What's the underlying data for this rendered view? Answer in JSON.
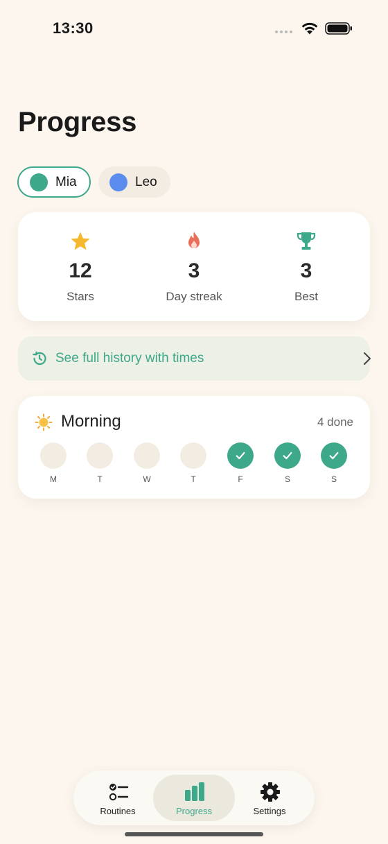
{
  "status_bar": {
    "time": "13:30"
  },
  "page": {
    "title": "Progress"
  },
  "profiles": [
    {
      "name": "Mia",
      "color": "#3ea88a",
      "selected": true
    },
    {
      "name": "Leo",
      "color": "#5b8def",
      "selected": false
    }
  ],
  "stats": [
    {
      "icon": "star-icon",
      "value": "12",
      "label": "Stars",
      "color": "#f5b82e"
    },
    {
      "icon": "flame-icon",
      "value": "3",
      "label": "Day streak",
      "color": "#ea6f5a"
    },
    {
      "icon": "trophy-icon",
      "value": "3",
      "label": "Best",
      "color": "#3ea88a"
    }
  ],
  "history_link": {
    "label": "See full history with times"
  },
  "routine": {
    "title": "Morning",
    "count": "4 done",
    "days": [
      {
        "label": "M",
        "done": false
      },
      {
        "label": "T",
        "done": false
      },
      {
        "label": "W",
        "done": false
      },
      {
        "label": "T",
        "done": false
      },
      {
        "label": "F",
        "done": true
      },
      {
        "label": "S",
        "done": true
      },
      {
        "label": "S",
        "done": true
      }
    ]
  },
  "tab_bar": {
    "items": [
      {
        "label": "Routines",
        "icon": "checklist-icon",
        "active": false
      },
      {
        "label": "Progress",
        "icon": "bar-chart-icon",
        "active": true
      },
      {
        "label": "Settings",
        "icon": "gear-icon",
        "active": false
      }
    ]
  },
  "colors": {
    "accent": "#3ea88a",
    "background": "#fcf6ef"
  }
}
